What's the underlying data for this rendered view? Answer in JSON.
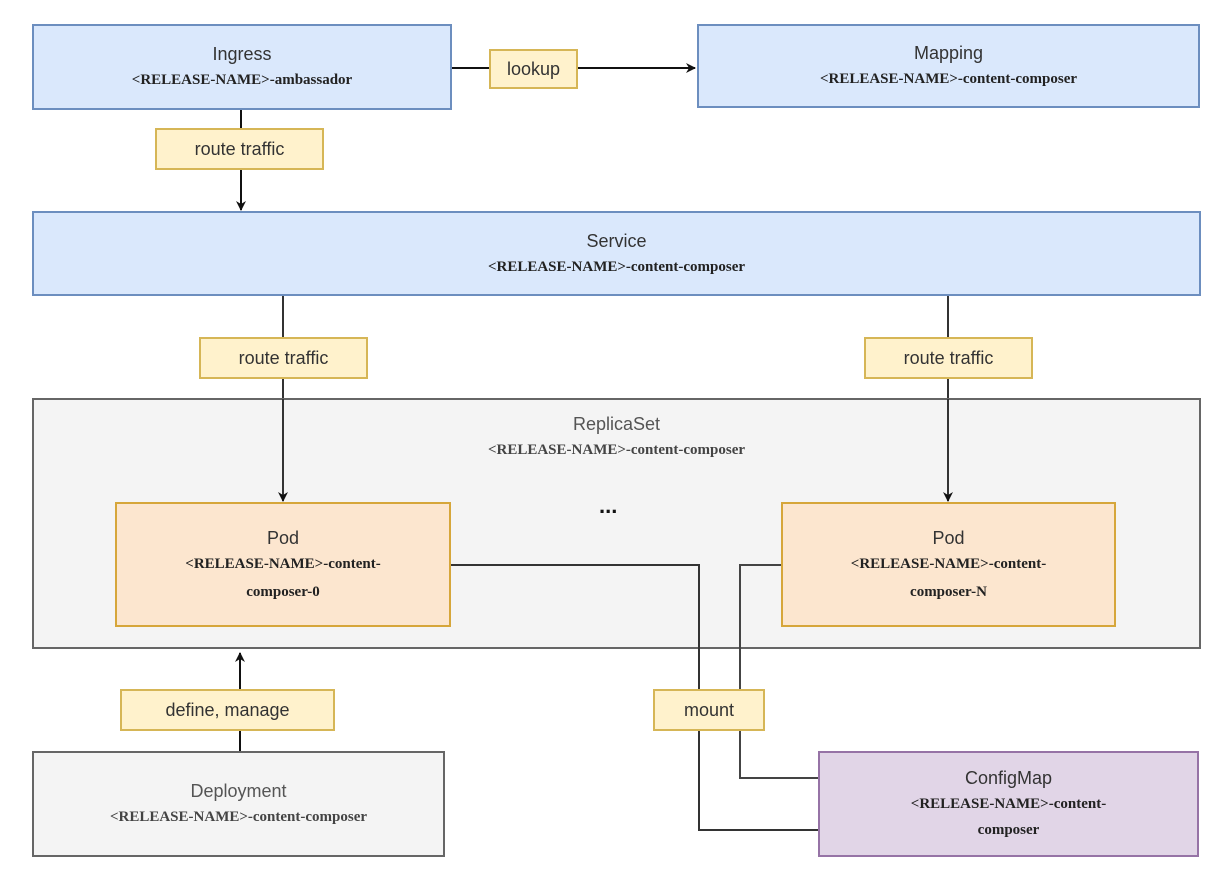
{
  "nodes": {
    "ingress": {
      "title": "Ingress",
      "subtitle": "<RELEASE-NAME>-ambassador"
    },
    "mapping": {
      "title": "Mapping",
      "subtitle": "<RELEASE-NAME>-content-composer"
    },
    "service": {
      "title": "Service",
      "subtitle": "<RELEASE-NAME>-content-composer"
    },
    "replicaset": {
      "title": "ReplicaSet",
      "subtitle": "<RELEASE-NAME>-content-composer"
    },
    "pod0": {
      "title": "Pod",
      "subtitle_line1": "<RELEASE-NAME>-content-",
      "subtitle_line2": "composer-0"
    },
    "podN": {
      "title": "Pod",
      "subtitle_line1": "<RELEASE-NAME>-content-",
      "subtitle_line2": "composer-N"
    },
    "deployment": {
      "title": "Deployment",
      "subtitle": "<RELEASE-NAME>-content-composer"
    },
    "configmap": {
      "title": "ConfigMap",
      "subtitle_line1": "<RELEASE-NAME>-content-",
      "subtitle_line2": "composer"
    }
  },
  "ellipsis": "...",
  "edges": [
    {
      "from": "ingress",
      "to": "mapping",
      "label": "lookup"
    },
    {
      "from": "ingress",
      "to": "service",
      "label": "route traffic"
    },
    {
      "from": "service",
      "to": "pod0",
      "label": "route traffic"
    },
    {
      "from": "service",
      "to": "podN",
      "label": "route traffic"
    },
    {
      "from": "deployment",
      "to": "replicaset",
      "label": "define, manage"
    },
    {
      "from": "pod0",
      "to": "configmap",
      "label": "mount"
    },
    {
      "from": "podN",
      "to": "configmap",
      "label": ""
    }
  ],
  "colors": {
    "k8s_blue_fill": "#dae8fc",
    "k8s_blue_stroke": "#6c8ebf",
    "gray_fill": "#f4f4f4",
    "gray_stroke": "#666666",
    "pod_fill": "#fce6cf",
    "pod_stroke": "#d6a63a",
    "configmap_fill": "#e1d5e7",
    "configmap_stroke": "#9673a6",
    "label_fill": "#fff2cc",
    "label_stroke": "#d6b656"
  }
}
